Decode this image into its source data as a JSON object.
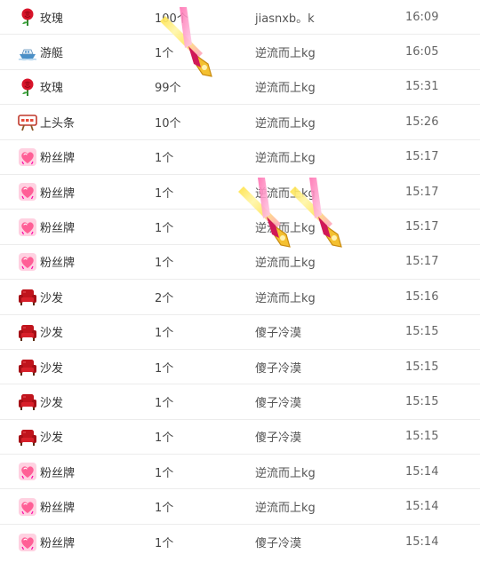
{
  "gift_log": {
    "rows": [
      {
        "gift": "玫瑰",
        "icon": "rose-icon",
        "qty": "100个",
        "sender": "jiasnxb。k",
        "time": "16:09"
      },
      {
        "gift": "游艇",
        "icon": "yacht-icon",
        "qty": "1个",
        "sender": "逆流而上kg",
        "time": "16:05"
      },
      {
        "gift": "玫瑰",
        "icon": "rose-icon",
        "qty": "99个",
        "sender": "逆流而上kg",
        "time": "15:31"
      },
      {
        "gift": "上头条",
        "icon": "headline-sign-icon",
        "qty": "10个",
        "sender": "逆流而上kg",
        "time": "15:26"
      },
      {
        "gift": "粉丝牌",
        "icon": "fan-badge-heart-icon",
        "qty": "1个",
        "sender": "逆流而上kg",
        "time": "15:17"
      },
      {
        "gift": "粉丝牌",
        "icon": "fan-badge-heart-icon",
        "qty": "1个",
        "sender": "逆流而上kg",
        "time": "15:17"
      },
      {
        "gift": "粉丝牌",
        "icon": "fan-badge-heart-icon",
        "qty": "1个",
        "sender": "逆流而上kg",
        "time": "15:17"
      },
      {
        "gift": "粉丝牌",
        "icon": "fan-badge-heart-icon",
        "qty": "1个",
        "sender": "逆流而上kg",
        "time": "15:17"
      },
      {
        "gift": "沙发",
        "icon": "sofa-icon",
        "qty": "2个",
        "sender": "逆流而上kg",
        "time": "15:16"
      },
      {
        "gift": "沙发",
        "icon": "sofa-icon",
        "qty": "1个",
        "sender": "傻子冷漠",
        "time": "15:15"
      },
      {
        "gift": "沙发",
        "icon": "sofa-icon",
        "qty": "1个",
        "sender": "傻子冷漠",
        "time": "15:15"
      },
      {
        "gift": "沙发",
        "icon": "sofa-icon",
        "qty": "1个",
        "sender": "傻子冷漠",
        "time": "15:15"
      },
      {
        "gift": "沙发",
        "icon": "sofa-icon",
        "qty": "1个",
        "sender": "傻子冷漠",
        "time": "15:15"
      },
      {
        "gift": "粉丝牌",
        "icon": "fan-badge-heart-icon",
        "qty": "1个",
        "sender": "逆流而上kg",
        "time": "15:14"
      },
      {
        "gift": "粉丝牌",
        "icon": "fan-badge-heart-icon",
        "qty": "1个",
        "sender": "逆流而上kg",
        "time": "15:14"
      },
      {
        "gift": "粉丝牌",
        "icon": "fan-badge-heart-icon",
        "qty": "1个",
        "sender": "傻子冷漠",
        "time": "15:14"
      }
    ]
  },
  "overlay": {
    "glowsticks": [
      {
        "icon": "glowstick-icon"
      },
      {
        "icon": "glowstick-icon"
      },
      {
        "icon": "glowstick-icon"
      }
    ]
  },
  "colors": {
    "row_border": "#ececec",
    "text": "#333333",
    "time_text": "#666666"
  }
}
